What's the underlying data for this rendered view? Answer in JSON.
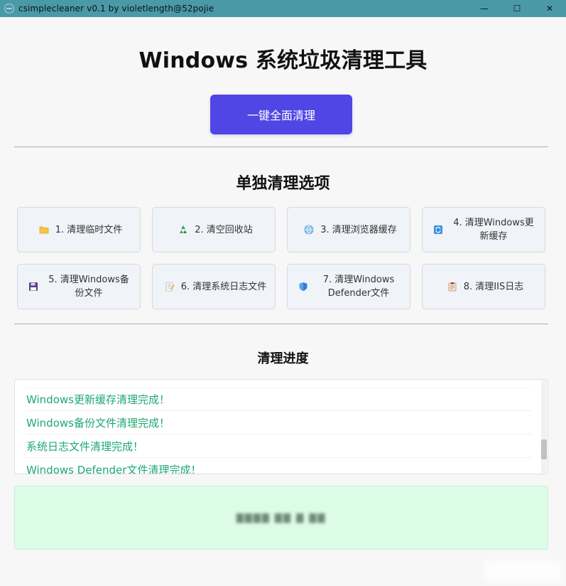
{
  "window": {
    "title": "csimplecleaner v0.1 by violetlength@52pojie",
    "controls": {
      "minimize": "—",
      "maximize": "☐",
      "close": "✕"
    }
  },
  "header": {
    "title": "Windows 系统垃圾清理工具",
    "clean_all_button": "一键全面清理"
  },
  "options": {
    "section_title": "单独清理选项",
    "items": [
      {
        "label": "1. 清理临时文件",
        "icon": "folder-icon"
      },
      {
        "label": "2. 清空回收站",
        "icon": "recycle-icon"
      },
      {
        "label": "3. 清理浏览器缓存",
        "icon": "globe-icon"
      },
      {
        "label": "4. 清理Windows更新缓存",
        "icon": "refresh-icon"
      },
      {
        "label": "5. 清理Windows备份文件",
        "icon": "floppy-disk-icon"
      },
      {
        "label": "6. 清理系统日志文件",
        "icon": "memo-icon"
      },
      {
        "label": "7. 清理Windows Defender文件",
        "icon": "shield-icon"
      },
      {
        "label": "8. 清理IIS日志",
        "icon": "clipboard-icon"
      }
    ]
  },
  "progress": {
    "section_title": "清理进度",
    "logs": [
      "Windows更新缓存清理完成！",
      "Windows备份文件清理完成！",
      "系统日志文件清理完成！",
      "Windows Defender文件清理完成！"
    ],
    "log_color": "#1ea872"
  },
  "colors": {
    "titlebar": "#4a99a7",
    "accent": "#5046e5",
    "status_bg": "#dcfce6"
  }
}
